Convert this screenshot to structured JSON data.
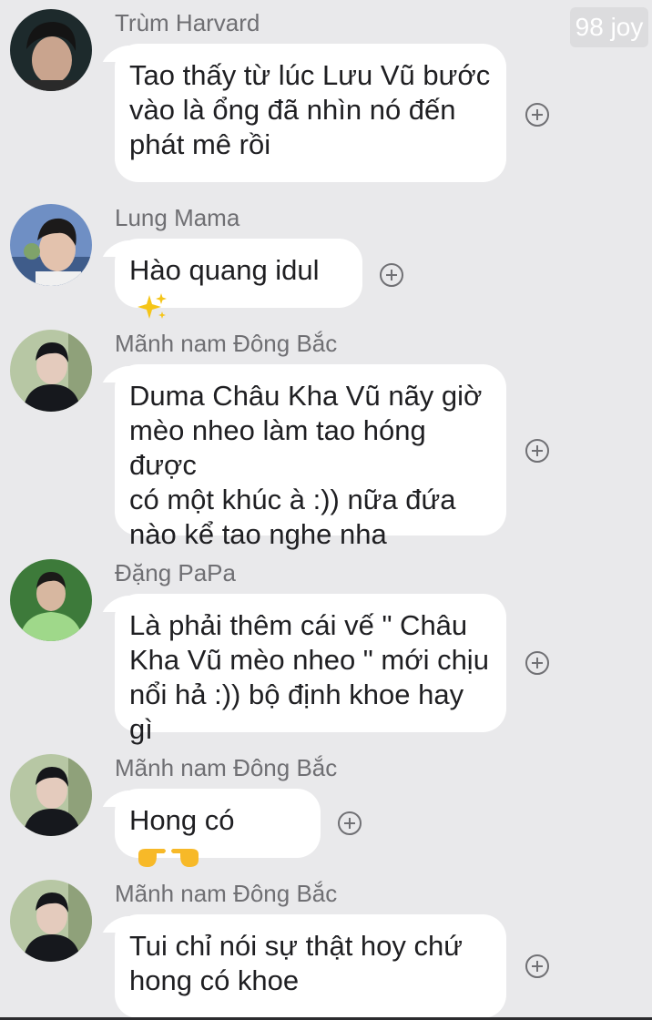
{
  "watermark": "98 joy",
  "messages": [
    {
      "sender": "Trùm Harvard",
      "avatar": "avatar-dark-hair-boy",
      "lines": [
        "Tao thấy từ lúc Lưu Vũ bước",
        "vào là ổng đã nhìn nó đến",
        "phát mê rồi"
      ],
      "emoji": ""
    },
    {
      "sender": "Lung Mama",
      "avatar": "avatar-flower-boy",
      "lines": [
        "Hào quang idul"
      ],
      "emoji": "sparkles-icon"
    },
    {
      "sender": "Mãnh nam Đông Bắc",
      "avatar": "avatar-black-suit",
      "lines": [
        "Duma Châu Kha Vũ nãy giờ",
        "mèo nheo làm tao hóng được",
        "có một khúc à :)) nữa đứa",
        "nào kể tao nghe nha"
      ],
      "emoji": ""
    },
    {
      "sender": "Đặng PaPa",
      "avatar": "avatar-green-shirt",
      "lines": [
        "Là phải thêm cái vế \" Châu",
        "Kha Vũ mèo nheo \" mới chịu",
        "nổi hả :)) bộ định khoe hay gì"
      ],
      "emoji": ""
    },
    {
      "sender": "Mãnh nam Đông Bắc",
      "avatar": "avatar-black-suit",
      "lines": [
        "Hong có"
      ],
      "emoji": "pointing-hands-icon"
    },
    {
      "sender": "Mãnh nam Đông Bắc",
      "avatar": "avatar-black-suit",
      "lines": [
        "Tui chỉ nói sự thật hoy chứ",
        "hong có khoe"
      ],
      "emoji": ""
    }
  ]
}
